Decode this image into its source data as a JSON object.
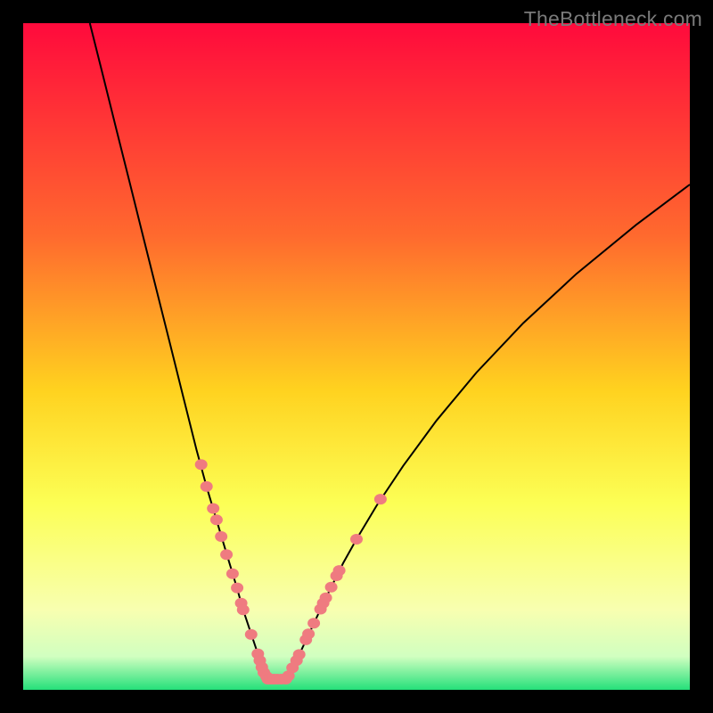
{
  "watermark_label": "TheBottleneck.com",
  "colors": {
    "frame_bg": "#000000",
    "grad_top": "#ff0a3c",
    "grad_mid1": "#ff6a2e",
    "grad_mid2": "#ffd21f",
    "grad_mid3": "#fcff55",
    "grad_mid4": "#f8ffb0",
    "grad_mid5": "#d1ffc0",
    "grad_bottom": "#25e07a",
    "curve": "#000000",
    "marker_fill": "#ef7b80"
  },
  "chart_data": {
    "type": "line",
    "title": "",
    "xlabel": "",
    "ylabel": "",
    "xlim": [
      0,
      100
    ],
    "ylim": [
      0,
      100
    ],
    "series": [
      {
        "name": "bottleneck-curve",
        "x": [
          10,
          12,
          14,
          16,
          18,
          20,
          22,
          24,
          26,
          27.5,
          29,
          30.5,
          32,
          33,
          34,
          35,
          35.5,
          36.7,
          39.4,
          41,
          44,
          46,
          48,
          50,
          53,
          57,
          62,
          68,
          75,
          83,
          92,
          100
        ],
        "y": [
          100,
          92,
          84,
          76,
          68,
          60,
          52,
          44,
          36,
          30.5,
          25.5,
          20.5,
          15.5,
          12,
          9,
          6,
          4.4,
          1.6,
          1.6,
          4.4,
          10.8,
          15,
          19,
          22.6,
          27.6,
          33.6,
          40.4,
          47.6,
          55,
          62.4,
          69.8,
          75.8
        ]
      }
    ],
    "markers": {
      "name": "curve-dots",
      "points": [
        [
          26.7,
          33.8
        ],
        [
          27.5,
          30.5
        ],
        [
          28.5,
          27.2
        ],
        [
          29.0,
          25.5
        ],
        [
          29.7,
          23.0
        ],
        [
          30.5,
          20.3
        ],
        [
          31.4,
          17.4
        ],
        [
          32.1,
          15.3
        ],
        [
          32.7,
          13.0
        ],
        [
          33.0,
          12.0
        ],
        [
          34.2,
          8.3
        ],
        [
          35.2,
          5.4
        ],
        [
          35.5,
          4.4
        ],
        [
          35.8,
          3.4
        ],
        [
          36.1,
          2.6
        ],
        [
          36.5,
          2.0
        ],
        [
          36.7,
          1.6
        ],
        [
          37.1,
          1.6
        ],
        [
          37.6,
          1.6
        ],
        [
          38.1,
          1.6
        ],
        [
          38.7,
          1.6
        ],
        [
          39.4,
          1.6
        ],
        [
          39.8,
          2.1
        ],
        [
          40.4,
          3.3
        ],
        [
          41.0,
          4.4
        ],
        [
          41.4,
          5.3
        ],
        [
          42.4,
          7.5
        ],
        [
          42.8,
          8.4
        ],
        [
          43.6,
          10.0
        ],
        [
          44.6,
          12.1
        ],
        [
          45.0,
          13.0
        ],
        [
          45.4,
          13.8
        ],
        [
          46.2,
          15.4
        ],
        [
          47.0,
          17.1
        ],
        [
          47.4,
          17.9
        ],
        [
          50.0,
          22.6
        ],
        [
          53.6,
          28.6
        ]
      ]
    }
  }
}
